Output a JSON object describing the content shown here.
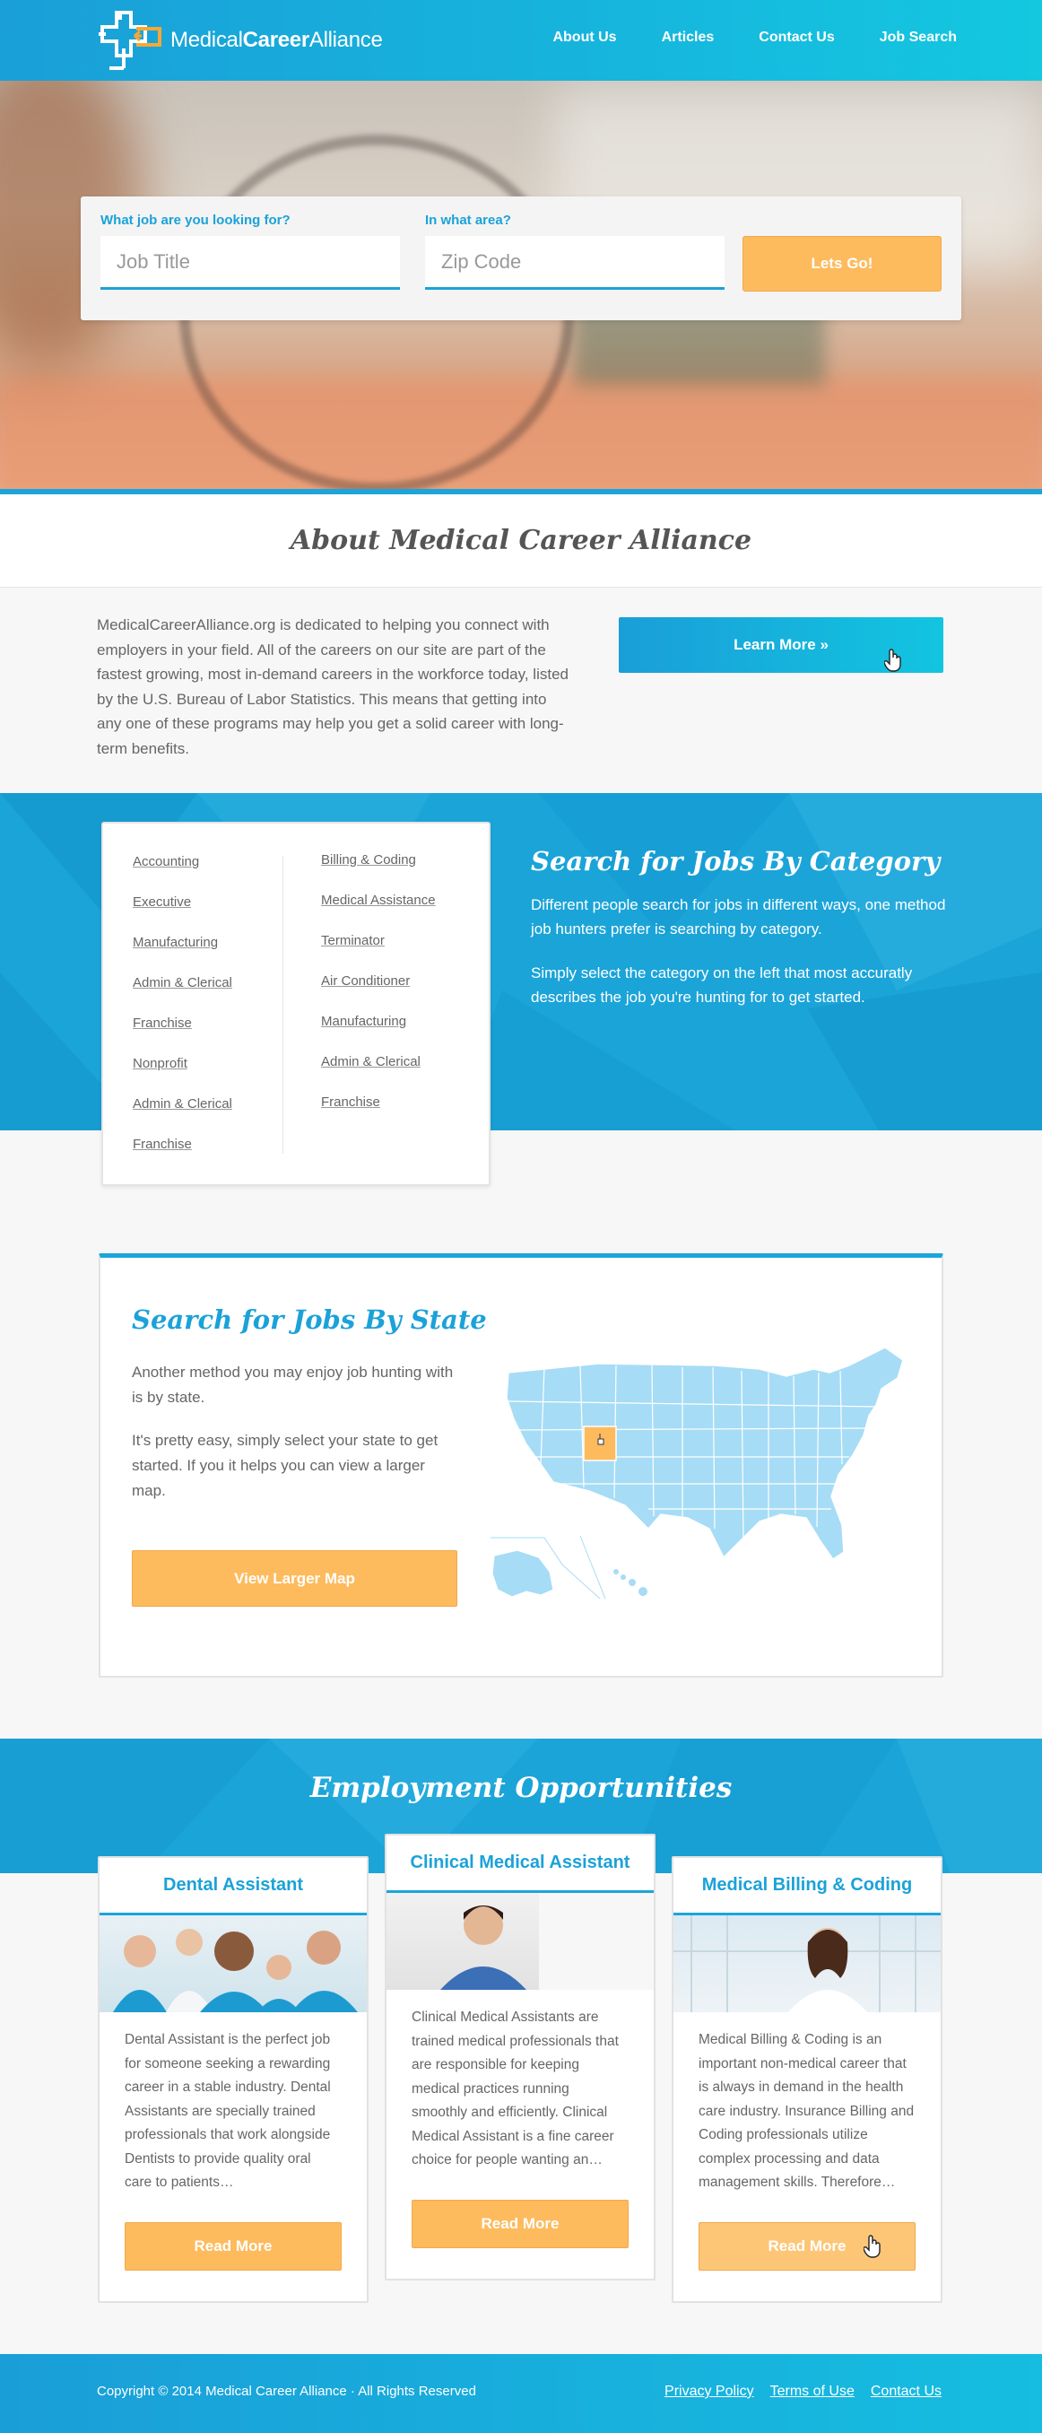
{
  "brand": {
    "name_light": "Medical",
    "name_bold_1": "Career",
    "name_rest": "Alliance"
  },
  "nav": [
    {
      "label": "About Us"
    },
    {
      "label": "Articles"
    },
    {
      "label": "Contact Us"
    },
    {
      "label": "Job Search"
    }
  ],
  "search": {
    "job_label": "What job are you looking for?",
    "job_placeholder": "Job Title",
    "area_label": "In what area?",
    "area_placeholder": "Zip Code",
    "submit_label": "Lets Go!"
  },
  "about": {
    "title": "About Medical Career Alliance",
    "body": "MedicalCareerAlliance.org is dedicated to helping you connect with employers in your field. All of the careers on our site are part of the fastest growing, most in-demand careers in the workforce today, listed by the U.S. Bureau of Labor Statistics. This means that getting into any one of these programs may help you get a solid career with long-term benefits.",
    "button_label": "Learn More »"
  },
  "categories": {
    "title": "Search for Jobs By Category",
    "p1": "Different people search for jobs in different ways, one method job hunters prefer is searching by category.",
    "p2": "Simply select the category on the left that most accuratly describes the job you're hunting for to get started.",
    "col1": [
      "Accounting",
      "Executive",
      "Manufacturing",
      "Admin & Clerical",
      "Franchise",
      "Nonprofit",
      "Admin & Clerical",
      "Franchise"
    ],
    "col2": [
      "Billing & Coding",
      "Medical Assistance",
      "Terminator",
      "Air Conditioner",
      "Manufacturing",
      "Admin & Clerical",
      "Franchise"
    ]
  },
  "state": {
    "title": "Search for Jobs By State",
    "p1": "Another method you may enjoy job hunting with is by state.",
    "p2": "It's pretty easy, simply select your state to get started. If you it helps you can view a larger map.",
    "button_label": "View Larger Map",
    "highlight_color": "#fdbb5e",
    "map_color": "#a6dcf6"
  },
  "employment": {
    "title": "Employment Opportunities",
    "jobs": [
      {
        "title": "Dental Assistant",
        "description": "Dental Assistant is the perfect job for someone seeking a rewarding career in a stable industry. Dental Assistants are specially trained professionals that work alongside Dentists to provide quality oral care to patients…",
        "button": "Read More"
      },
      {
        "title": "Clinical Medical Assistant",
        "description": "Clinical Medical Assistants are trained medical professionals that are responsible for keeping medical practices running smoothly and efficiently. Clinical Medical Assistant is a fine career choice for people wanting an…",
        "button": "Read More"
      },
      {
        "title": "Medical Billing & Coding",
        "description": "Medical Billing & Coding is an important non-medical career that is always in demand in the health care industry. Insurance Billing and Coding professionals utilize complex processing and data management skills. Therefore…",
        "button": "Read More"
      }
    ]
  },
  "footer": {
    "copyright": "Copyright © 2014 Medical Career Alliance · All Rights Reserved",
    "links": [
      "Privacy Policy",
      "Terms of Use",
      "Contact Us"
    ]
  },
  "colors": {
    "primary": "#1ba4d8",
    "accent": "#fdbb5e"
  }
}
